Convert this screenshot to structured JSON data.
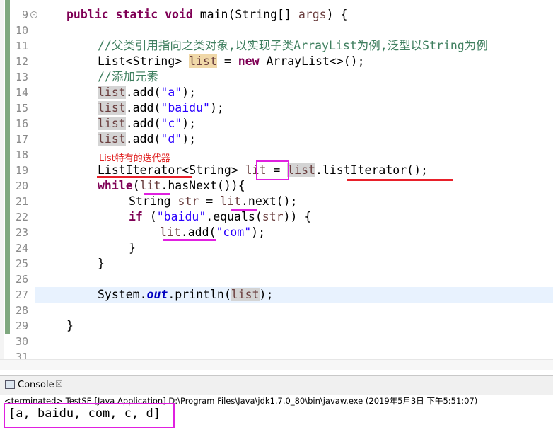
{
  "editor": {
    "lines": [
      {
        "num": "9"
      },
      {
        "num": "10"
      },
      {
        "num": "11"
      },
      {
        "num": "12"
      },
      {
        "num": "13"
      },
      {
        "num": "14"
      },
      {
        "num": "15"
      },
      {
        "num": "16"
      },
      {
        "num": "17"
      },
      {
        "num": "18"
      },
      {
        "num": "19"
      },
      {
        "num": "20"
      },
      {
        "num": "21"
      },
      {
        "num": "22"
      },
      {
        "num": "23"
      },
      {
        "num": "24"
      },
      {
        "num": "25"
      },
      {
        "num": "26"
      },
      {
        "num": "27"
      },
      {
        "num": "28"
      },
      {
        "num": "29"
      },
      {
        "num": "30"
      },
      {
        "num": "31"
      }
    ],
    "code": {
      "l9_kw": "public static void",
      "l9_rest": " main(String[] ",
      "l9_args": "args",
      "l9_end": ") {",
      "l11": "//父类引用指向之类对象,以实现子类ArrayList为例,泛型以String为例",
      "l12_type": "List<String> ",
      "l12_var": "list",
      "l12_eq": " = ",
      "l12_new": "new",
      "l12_rest": " ArrayList<>();",
      "l13": "//添加元素",
      "var_list": "list",
      "l14_rest": ".add(",
      "l14_str": "\"a\"",
      "l15_str": "\"baidu\"",
      "l16_str": "\"c\"",
      "l17_str": "\"d\"",
      "close_paren": ");",
      "l19_type": "ListIterator",
      "l19_gen": "<String> ",
      "var_lit": "lit",
      "l19_eq": " = ",
      "l19_call": ".listIterator();",
      "l20_kw": "while",
      "l20_open": "(",
      "l20_rest": ".hasNext()){",
      "l21_type": "String ",
      "l21_var": "str",
      "l21_eq": " = ",
      "l21_rest": ".next();",
      "l22_kw": "if",
      "l22_open": " (",
      "l22_str": "\"baidu\"",
      "l22_rest": ".equals(",
      "l22_end": ")) {",
      "l23_rest": ".add(",
      "l23_str": "\"com\"",
      "l24": "}",
      "l25": "}",
      "l27_sys": "System.",
      "l27_out": "out",
      "l27_rest": ".println(",
      "l29": "}"
    },
    "annotation": "List特有的迭代器"
  },
  "console": {
    "tab_label": "Console",
    "close_glyph": "☒",
    "terminated_line": "<terminated> TestSE [Java Application] D:\\Program Files\\Java\\jdk1.7.0_80\\bin\\javaw.exe (2019年5月3日 下午5:51:07)",
    "output": "[a, baidu, com, c, d]"
  },
  "colors": {
    "keyword": "#7f0055",
    "string": "#2a00ff",
    "comment": "#3f7f5f",
    "annotation_red": "#e8202a",
    "annotation_magenta": "#e020e0"
  }
}
